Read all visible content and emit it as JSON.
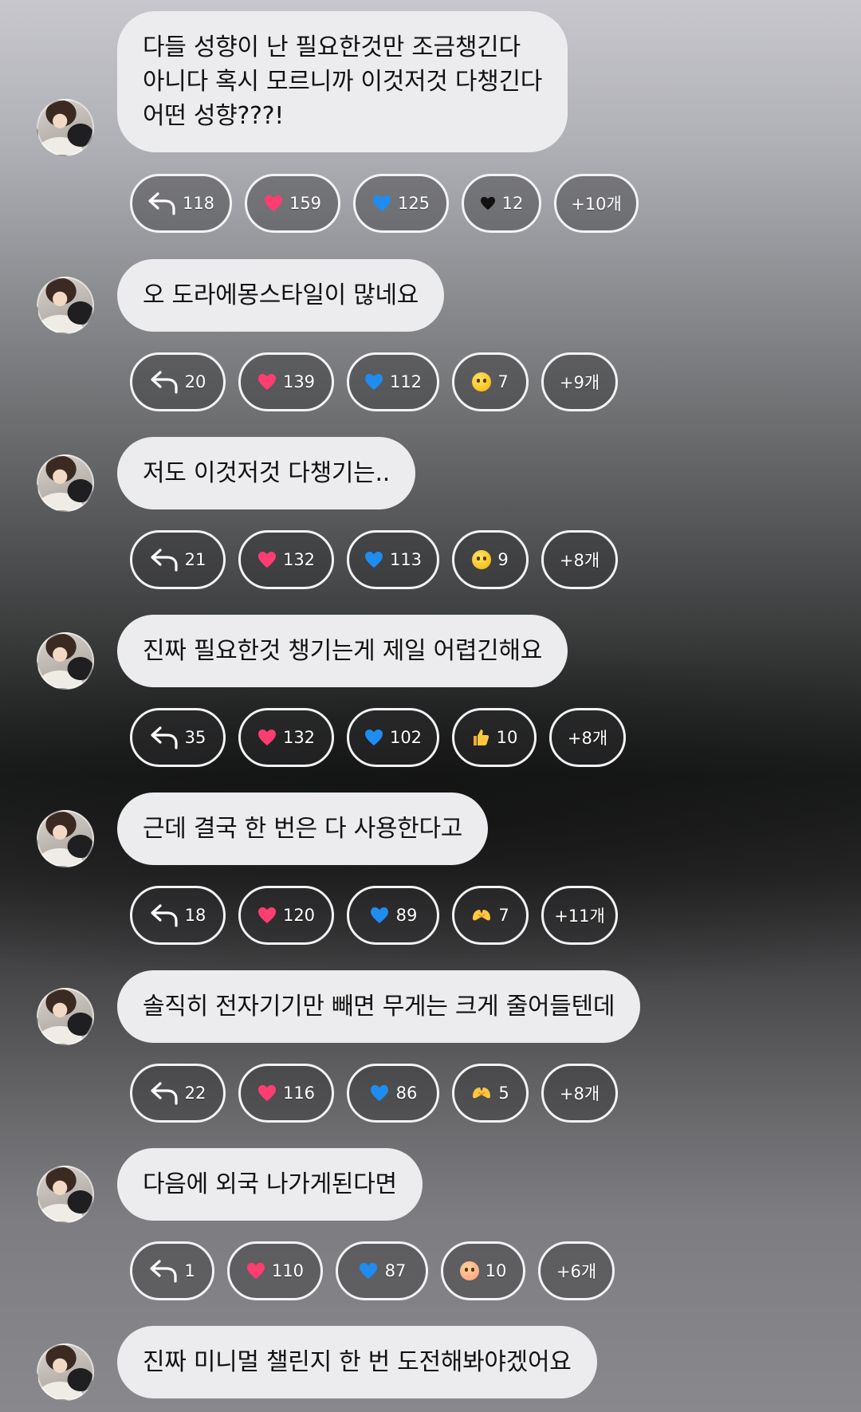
{
  "colors": {
    "bubble_bg": "#ececee",
    "chip_border": "#f3f3f5",
    "heart_pink": "#ff3d71",
    "heart_blue": "#1f8cf0",
    "heart_black": "#111111"
  },
  "messages": [
    {
      "text": "다들 성향이 난 필요한것만 조금챙긴다\n아니다 혹시 모르니까 이것저것 다챙긴다\n어떤 성향???!",
      "reactions": {
        "reply": "118",
        "pink": "159",
        "blue": "125",
        "extra_icon": "black-heart-icon",
        "extra": "12",
        "more": "+10개"
      }
    },
    {
      "text": "오 도라에몽스타일이 많네요",
      "reactions": {
        "reply": "20",
        "pink": "139",
        "blue": "112",
        "extra_icon": "laughing-tears-emoji-icon",
        "extra": "7",
        "more": "+9개"
      }
    },
    {
      "text": "저도 이것저것 다챙기는..",
      "reactions": {
        "reply": "21",
        "pink": "132",
        "blue": "113",
        "extra_icon": "surprised-face-emoji-icon",
        "extra": "9",
        "more": "+8개"
      }
    },
    {
      "text": "진짜 필요한것 챙기는게 제일 어렵긴해요",
      "reactions": {
        "reply": "35",
        "pink": "132",
        "blue": "102",
        "extra_icon": "thumbs-up-emoji-icon",
        "extra": "10",
        "more": "+8개"
      }
    },
    {
      "text": "근데 결국 한 번은 다 사용한다고",
      "reactions": {
        "reply": "18",
        "pink": "120",
        "blue": "89",
        "extra_icon": "heart-hands-emoji-icon",
        "extra": "7",
        "more": "+11개"
      }
    },
    {
      "text": "솔직히 전자기기만 빼면 무게는 크게 줄어들텐데",
      "reactions": {
        "reply": "22",
        "pink": "116",
        "blue": "86",
        "extra_icon": "heart-hands-emoji-icon",
        "extra": "5",
        "more": "+8개"
      }
    },
    {
      "text": "다음에 외국 나가게된다면",
      "reactions": {
        "reply": "1",
        "pink": "110",
        "blue": "87",
        "extra_icon": "smiling-hearts-emoji-icon",
        "extra": "10",
        "more": "+6개"
      }
    },
    {
      "text": "진짜 미니멀 챌린지 한 번 도전해봐야겠어요",
      "reactions": null
    }
  ]
}
